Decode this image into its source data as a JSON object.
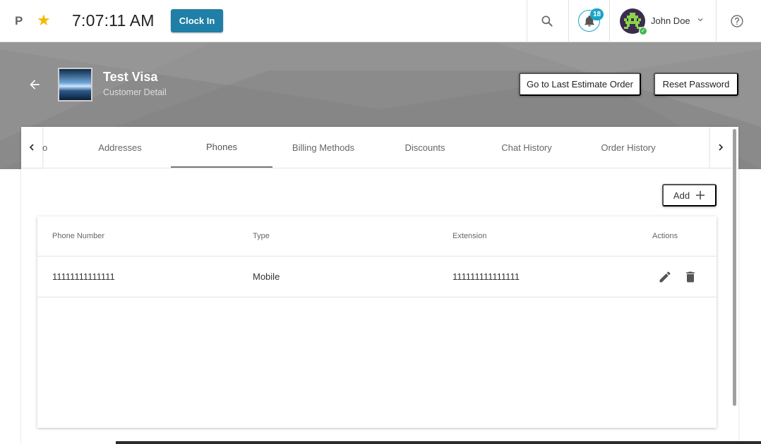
{
  "topbar": {
    "brand": "P",
    "time": "7:07:11 AM",
    "clock_in_label": "Clock In",
    "notifications_count": "18",
    "user_name": "John Doe"
  },
  "header": {
    "title": "Test Visa",
    "subtitle": "Customer Detail",
    "last_estimate_label": "Go to Last Estimate Order",
    "reset_password_label": "Reset Password"
  },
  "tabs": {
    "partial_label": "o",
    "items": [
      "Addresses",
      "Phones",
      "Billing Methods",
      "Discounts",
      "Chat History",
      "Order History"
    ],
    "active": "Phones"
  },
  "phones": {
    "add_label": "Add",
    "columns": [
      "Phone Number",
      "Type",
      "Extension",
      "Actions"
    ],
    "rows": [
      {
        "phone": "11111111111111",
        "type": "Mobile",
        "extension": "111111111111111"
      }
    ]
  },
  "colors": {
    "accent": "#1f7fa6",
    "badge": "#1aa3c9",
    "header_bg": "#8a8a8a",
    "star": "#f5b800"
  },
  "icons": [
    "star-icon",
    "search-icon",
    "bell-icon",
    "chevron-down-icon",
    "help-icon",
    "arrow-back-icon",
    "chevron-left-icon",
    "chevron-right-icon",
    "plus-icon",
    "edit-icon",
    "delete-icon"
  ]
}
